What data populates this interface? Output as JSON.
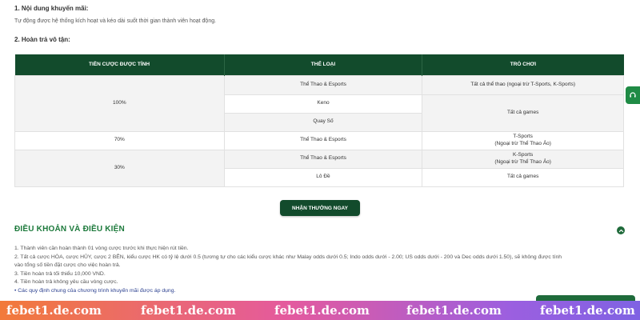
{
  "content": {
    "heading1": "1. Nội dung khuyến mãi:",
    "text1": "Tự động được hệ thống kích hoạt và kéo dài suốt thời gian thành viên hoạt động.",
    "heading2": "2. Hoàn trả vô tận:"
  },
  "table": {
    "headers": [
      "TIỀN CƯỢC ĐƯỢC TÍNH",
      "THỂ LOẠI",
      "TRÒ CHƠI"
    ],
    "cells": {
      "tier_100": "100%",
      "tier_70": "70%",
      "tier_30": "30%",
      "cat_sports_1": "Thể Thao & Esports",
      "cat_keno": "Keno",
      "cat_quayso": "Quay Số",
      "cat_sports_2": "Thể Thao & Esports",
      "cat_sports_3": "Thể Thao & Esports",
      "cat_lode": "Lô Đề",
      "game_all_sports": "Tất cả thể thao (ngoại trừ T-Sports, K-Sports)",
      "game_all_games_1": "Tất cả games",
      "game_tsports": "T-Sports",
      "game_tsports_note": "(Ngoại trừ Thể Thao Ảo)",
      "game_ksports": "K-Sports",
      "game_ksports_note": "(Ngoại trừ Thể Thao Ảo)",
      "game_all_games_2": "Tất cả games"
    }
  },
  "claim_button": "NHẬN THƯỞNG NGAY",
  "terms": {
    "title": "ĐIỀU KHOẢN VÀ ĐIỀU KIỆN",
    "items": [
      "1. Thành viên cần hoàn thành 01 vòng cược trước khi thực hiện rút tiền.",
      "2. Tất cả cược HÒA, cược HỦY, cược 2 BÊN, kiểu cược HK có tỷ lệ dưới 0.5 (tương tự cho các kiểu cược khác như Malay odds dưới 0.5; Indo odds dưới - 2.00; US odds dưới - 200 và Dec odds dưới 1.50), sẽ không được tính",
      "vào tổng số tiền đặt cược cho việc hoàn trả.",
      "3. Tiền hoàn trả tối thiểu 10,000 VND.",
      "4. Tiền hoàn trả không yêu cầu vòng cược.",
      "• Các quy định chung của chương trình khuyến mãi được áp dụng."
    ]
  },
  "watermark": [
    "febet1.de.com",
    "febet1.de.com",
    "febet1.de.com",
    "febet1.de.com",
    "febet1.de.com"
  ],
  "icons": {
    "support": "headset-icon",
    "toggle": "chevron-up-icon"
  },
  "colors": {
    "header_green": "#124b2c",
    "title_green": "#1d7a3c",
    "side_green": "#1f8b45"
  }
}
